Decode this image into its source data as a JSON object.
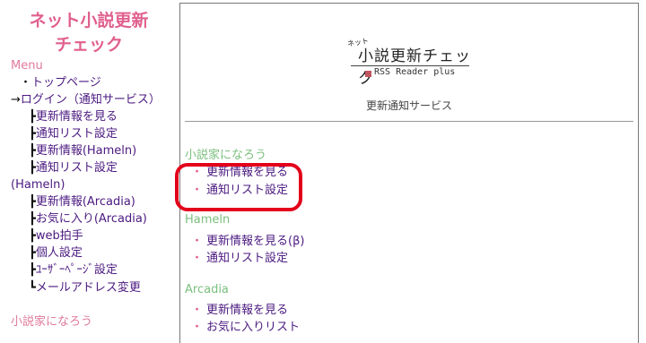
{
  "sidebar": {
    "title_line1": "ネット小説更新",
    "title_line2": "チェック",
    "menu_heading": "Menu",
    "items": [
      {
        "prefix": "・",
        "label": "トップページ"
      },
      {
        "prefix": "→",
        "label": "ログイン（通知サービス）"
      },
      {
        "prefix": "┣",
        "label": "更新情報を見る"
      },
      {
        "prefix": "┣",
        "label": "通知リスト設定"
      },
      {
        "prefix": "┣",
        "label": "更新情報(Hameln)"
      },
      {
        "prefix": "┣",
        "label": "通知リスト設定"
      },
      {
        "prefix": "",
        "label": "(Hameln)"
      },
      {
        "prefix": "┣",
        "label": "更新情報(Arcadia)"
      },
      {
        "prefix": "┣",
        "label": "お気に入り(Arcadia)"
      },
      {
        "prefix": "┣",
        "label": "web拍手"
      },
      {
        "prefix": "┣",
        "label": "個人設定"
      },
      {
        "prefix": "┣",
        "label": "ﾕｰｻﾞｰﾍﾟｰｼﾞ設定"
      },
      {
        "prefix": "┗",
        "label": "メールアドレス変更"
      }
    ],
    "section2_heading": "小説家になろう"
  },
  "main": {
    "logo_small": "ネット",
    "logo_main": "小説更新チェック",
    "logo_sub": "RSS Reader plus",
    "service_title": "更新通知サービス",
    "groups": [
      {
        "heading": "小説家になろう",
        "links": [
          "更新情報を見る",
          "通知リスト設定"
        ]
      },
      {
        "heading": "Hameln",
        "links": [
          "更新情報を見る(β)",
          "通知リスト設定"
        ]
      },
      {
        "heading": "Arcadia",
        "links": [
          "更新情報を見る",
          "お気に入りリスト"
        ]
      }
    ]
  }
}
